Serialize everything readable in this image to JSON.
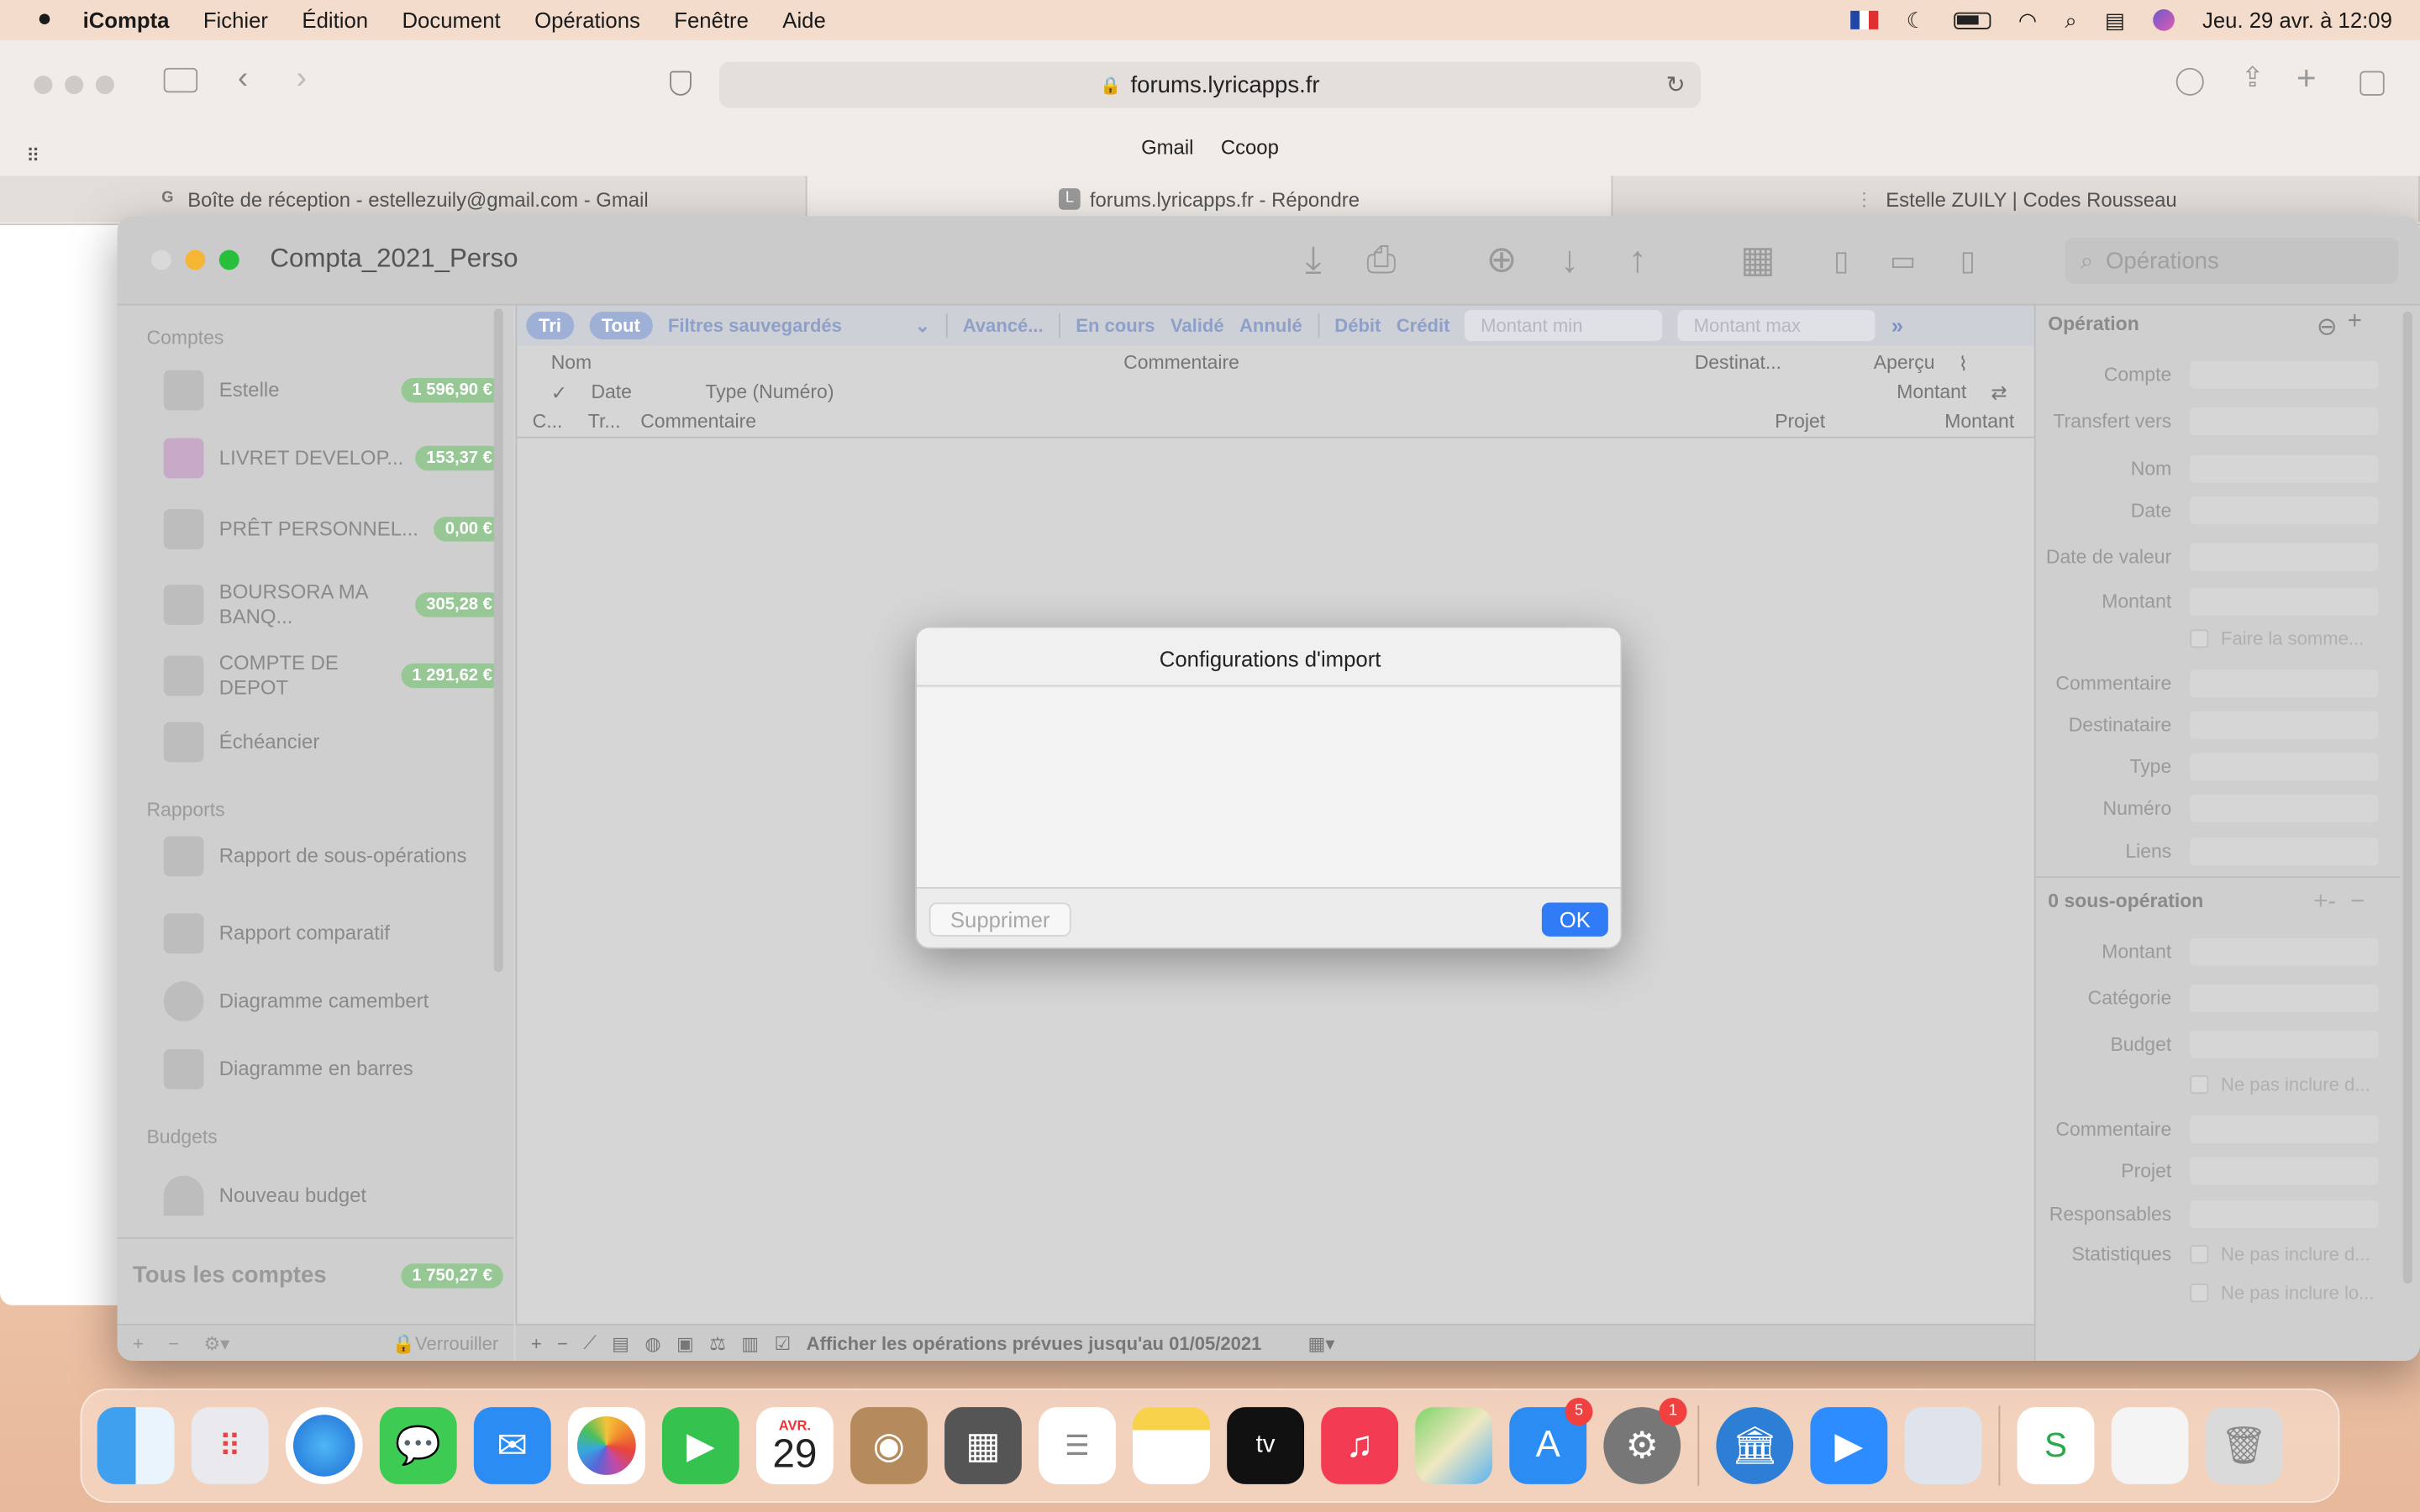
{
  "menubar": {
    "app": "iCompta",
    "items": [
      "Fichier",
      "Édition",
      "Document",
      "Opérations",
      "Fenêtre",
      "Aide"
    ],
    "datetime": "Jeu. 29 avr. à  12:09"
  },
  "safari": {
    "url": "forums.lyricapps.fr",
    "favorites": [
      "Gmail",
      "Ccoop"
    ],
    "tabs": [
      {
        "label": "Boîte de réception - estellezuily@gmail.com - Gmail",
        "icon": "G"
      },
      {
        "label": "forums.lyricapps.fr - Répondre",
        "icon": "L"
      },
      {
        "label": "Estelle ZUILY | Codes Rousseau",
        "icon": ""
      }
    ]
  },
  "window": {
    "title": "Compta_2021_Perso",
    "search_placeholder": "Opérations"
  },
  "sidebar": {
    "sections": {
      "accounts": "Comptes",
      "reports": "Rapports",
      "budgets": "Budgets"
    },
    "accounts": [
      {
        "label": "Estelle",
        "badge": "1 596,90 €"
      },
      {
        "label": "LIVRET DEVELOP...",
        "badge": "153,37 €"
      },
      {
        "label": "PRÊT PERSONNEL...",
        "badge": "0,00 €"
      },
      {
        "label": "BOURSORA MA BANQ...",
        "badge": "305,28 €"
      },
      {
        "label": "COMPTE DE DEPOT",
        "badge": "1 291,62 €"
      },
      {
        "label": "Échéancier",
        "badge": ""
      }
    ],
    "reports": [
      "Rapport de sous-opérations",
      "Rapport comparatif",
      "Diagramme camembert",
      "Diagramme en barres"
    ],
    "budgets": [
      "Nouveau budget"
    ],
    "all_accounts": {
      "label": "Tous les comptes",
      "badge": "1 750,27 €"
    },
    "lock": "Verrouiller"
  },
  "filters": {
    "sort": "Tri",
    "all": "Tout",
    "saved": "Filtres sauvegardés",
    "advanced": "Avancé...",
    "pending": "En cours",
    "validated": "Validé",
    "cancelled": "Annulé",
    "debit": "Débit",
    "credit": "Crédit",
    "min": "Montant min",
    "max": "Montant max"
  },
  "columns": {
    "row1": {
      "name": "Nom",
      "comment": "Commentaire",
      "dest": "Destinat...",
      "preview": "Aperçu"
    },
    "row2": {
      "check": "✓",
      "date": "Date",
      "type": "Type (Numéro)",
      "amount": "Montant"
    },
    "row3": {
      "c": "C...",
      "tr": "Tr...",
      "comment": "Commentaire",
      "project": "Projet",
      "amount": "Montant"
    }
  },
  "footer": {
    "show_planned": "Afficher les opérations prévues jusqu'au 01/05/2021"
  },
  "inspector": {
    "header": "Opération",
    "fields": [
      "Compte",
      "Transfert vers",
      "Nom",
      "Date",
      "Date de valeur",
      "Montant"
    ],
    "sum_label": "Faire la somme...",
    "fields2": [
      "Commentaire",
      "Destinataire",
      "Type",
      "Numéro",
      "Liens"
    ],
    "sub_header": "0 sous-opération",
    "sub_fields": [
      "Montant",
      "Catégorie",
      "Budget"
    ],
    "exclude1": "Ne pas inclure d...",
    "sub_fields2": [
      "Commentaire",
      "Projet",
      "Responsables"
    ],
    "stats": "Statistiques",
    "exclude2": "Ne pas inclure d...",
    "exclude3": "Ne pas inclure lo..."
  },
  "dialog": {
    "title": "Configurations d'import",
    "delete": "Supprimer",
    "ok": "OK"
  },
  "dock": {
    "calendar_month": "AVR.",
    "calendar_day": "29",
    "appstore_badge": "5",
    "settings_badge": "1"
  }
}
